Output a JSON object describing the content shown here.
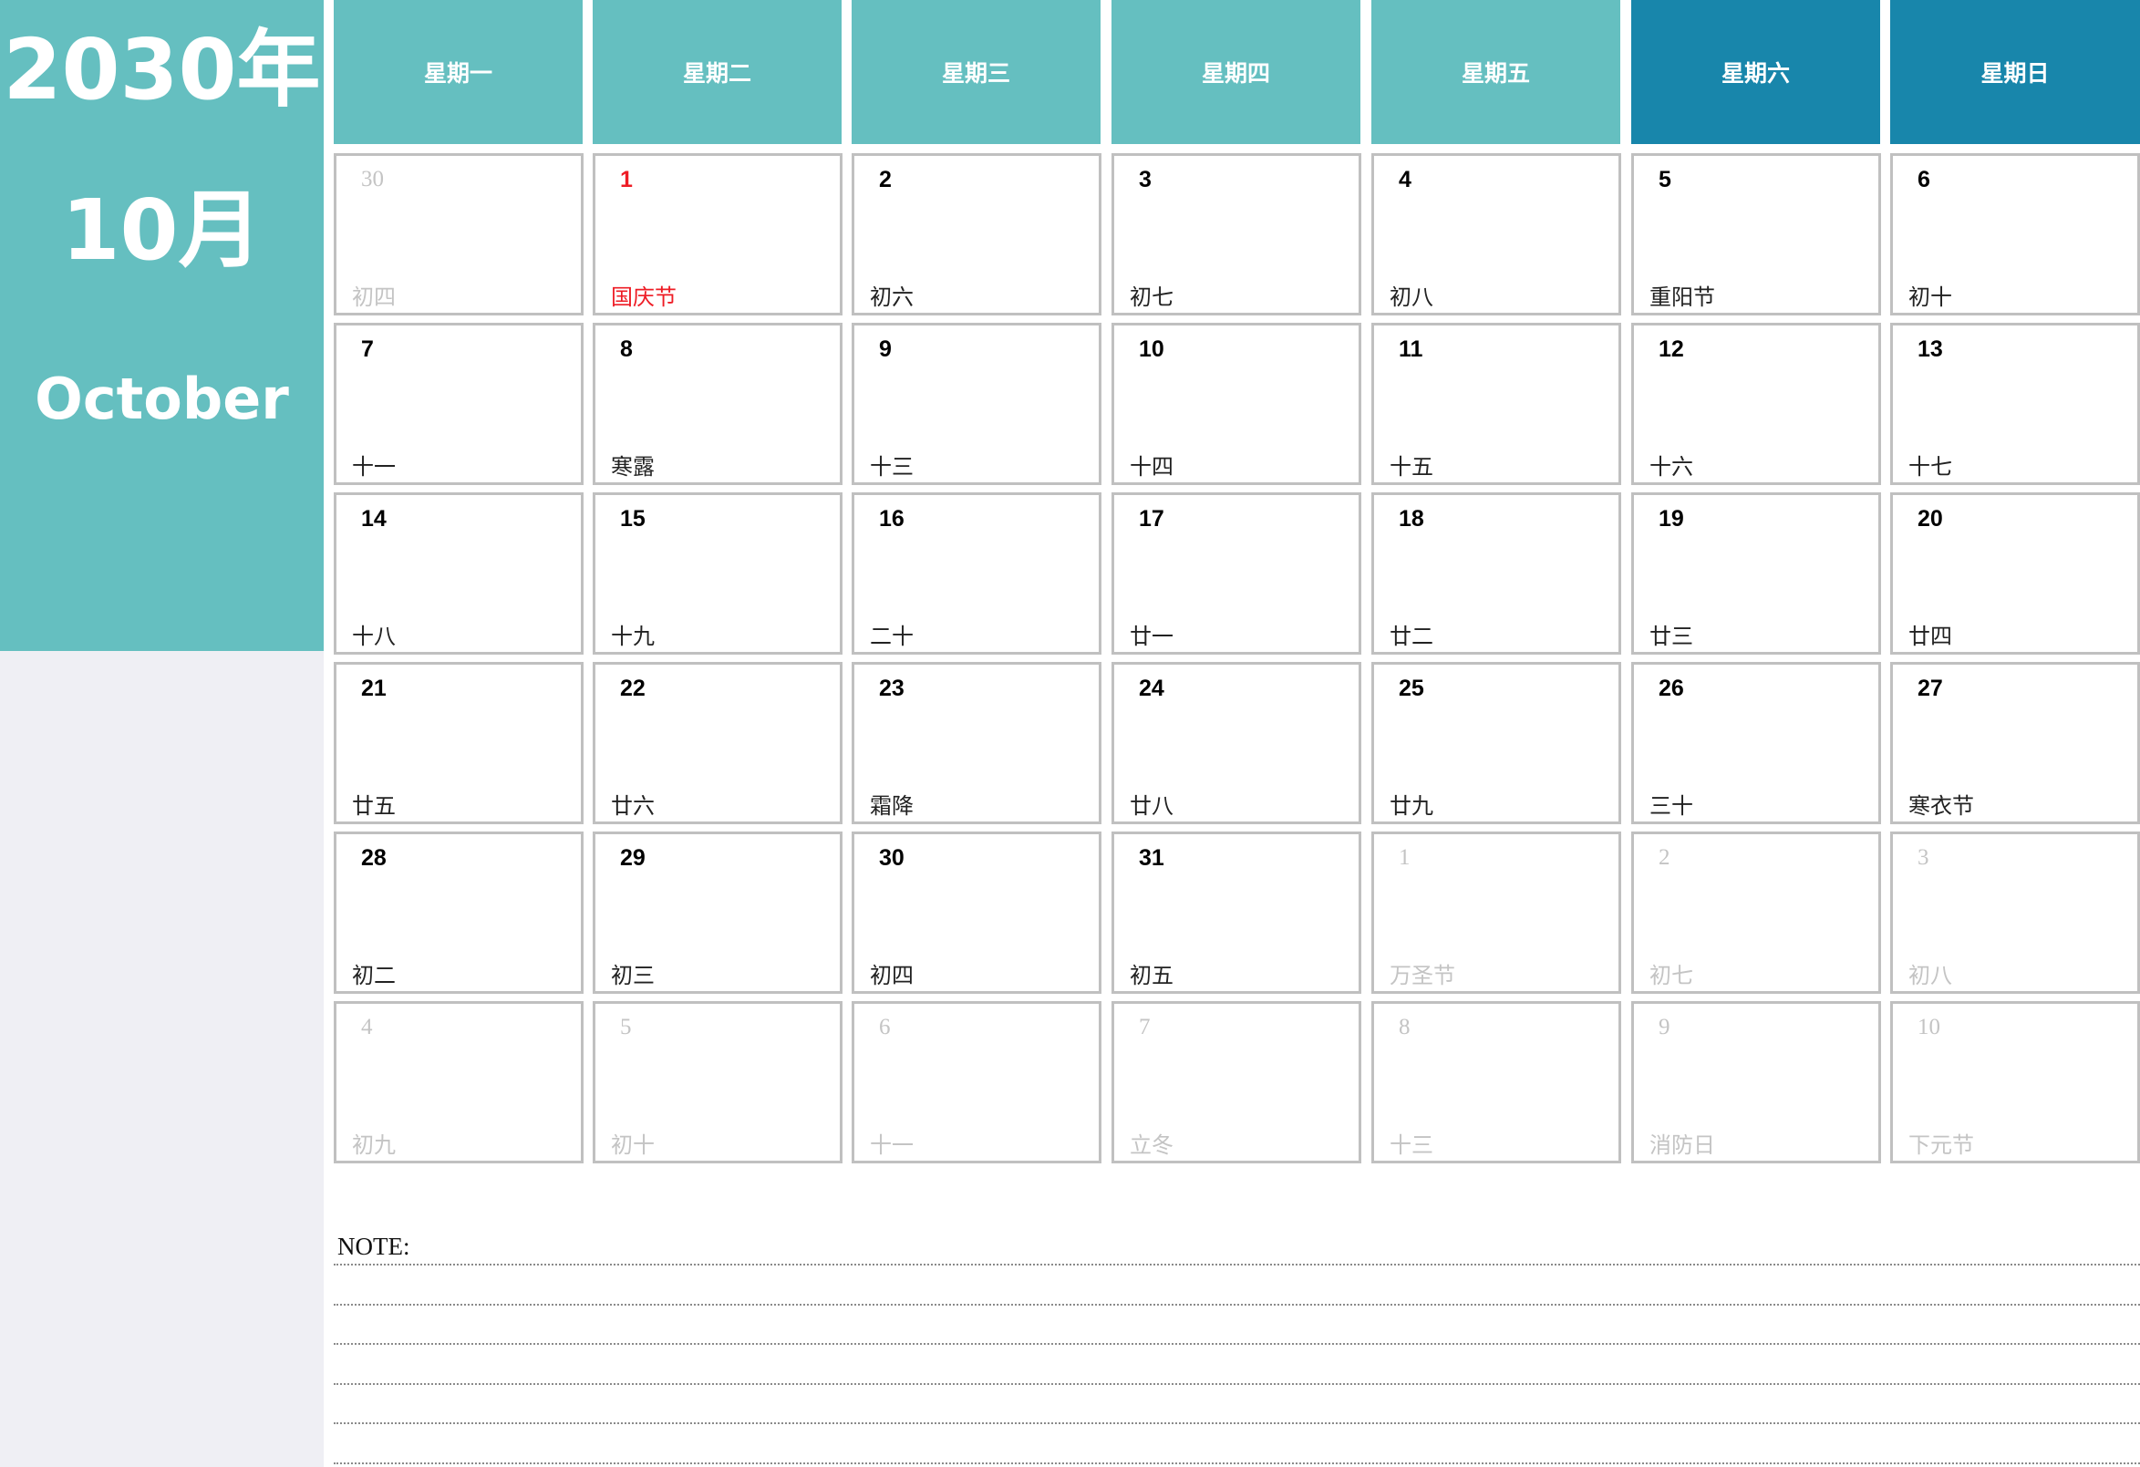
{
  "title": {
    "year": "2030年",
    "month": "10月",
    "month_en": "October"
  },
  "weekdays": [
    {
      "label": "星期一",
      "weekend": false
    },
    {
      "label": "星期二",
      "weekend": false
    },
    {
      "label": "星期三",
      "weekend": false
    },
    {
      "label": "星期四",
      "weekend": false
    },
    {
      "label": "星期五",
      "weekend": false
    },
    {
      "label": "星期六",
      "weekend": true
    },
    {
      "label": "星期日",
      "weekend": true
    }
  ],
  "colors": {
    "primary": "#65bfc0",
    "weekend": "#1886ab",
    "holiday": "#ee1c25",
    "muted": "#c4c4c4",
    "sidebar_bottom": "#efeff4"
  },
  "weeks": [
    [
      {
        "day": "30",
        "lunar": "初四",
        "other": true
      },
      {
        "day": "1",
        "lunar": "国庆节",
        "holiday": true
      },
      {
        "day": "2",
        "lunar": "初六"
      },
      {
        "day": "3",
        "lunar": "初七"
      },
      {
        "day": "4",
        "lunar": "初八"
      },
      {
        "day": "5",
        "lunar": "重阳节"
      },
      {
        "day": "6",
        "lunar": "初十"
      }
    ],
    [
      {
        "day": "7",
        "lunar": "十一"
      },
      {
        "day": "8",
        "lunar": "寒露"
      },
      {
        "day": "9",
        "lunar": "十三"
      },
      {
        "day": "10",
        "lunar": "十四"
      },
      {
        "day": "11",
        "lunar": "十五"
      },
      {
        "day": "12",
        "lunar": "十六"
      },
      {
        "day": "13",
        "lunar": "十七"
      }
    ],
    [
      {
        "day": "14",
        "lunar": "十八"
      },
      {
        "day": "15",
        "lunar": "十九"
      },
      {
        "day": "16",
        "lunar": "二十"
      },
      {
        "day": "17",
        "lunar": "廿一"
      },
      {
        "day": "18",
        "lunar": "廿二"
      },
      {
        "day": "19",
        "lunar": "廿三"
      },
      {
        "day": "20",
        "lunar": "廿四"
      }
    ],
    [
      {
        "day": "21",
        "lunar": "廿五"
      },
      {
        "day": "22",
        "lunar": "廿六"
      },
      {
        "day": "23",
        "lunar": "霜降"
      },
      {
        "day": "24",
        "lunar": "廿八"
      },
      {
        "day": "25",
        "lunar": "廿九"
      },
      {
        "day": "26",
        "lunar": "三十"
      },
      {
        "day": "27",
        "lunar": "寒衣节"
      }
    ],
    [
      {
        "day": "28",
        "lunar": "初二"
      },
      {
        "day": "29",
        "lunar": "初三"
      },
      {
        "day": "30",
        "lunar": "初四"
      },
      {
        "day": "31",
        "lunar": "初五"
      },
      {
        "day": "1",
        "lunar": "万圣节",
        "other": true
      },
      {
        "day": "2",
        "lunar": "初七",
        "other": true
      },
      {
        "day": "3",
        "lunar": "初八",
        "other": true
      }
    ],
    [
      {
        "day": "4",
        "lunar": "初九",
        "other": true
      },
      {
        "day": "5",
        "lunar": "初十",
        "other": true
      },
      {
        "day": "6",
        "lunar": "十一",
        "other": true
      },
      {
        "day": "7",
        "lunar": "立冬",
        "other": true
      },
      {
        "day": "8",
        "lunar": "十三",
        "other": true
      },
      {
        "day": "9",
        "lunar": "消防日",
        "other": true
      },
      {
        "day": "10",
        "lunar": "下元节",
        "other": true
      }
    ]
  ],
  "notes": {
    "label": "NOTE:",
    "line_count": 6
  }
}
